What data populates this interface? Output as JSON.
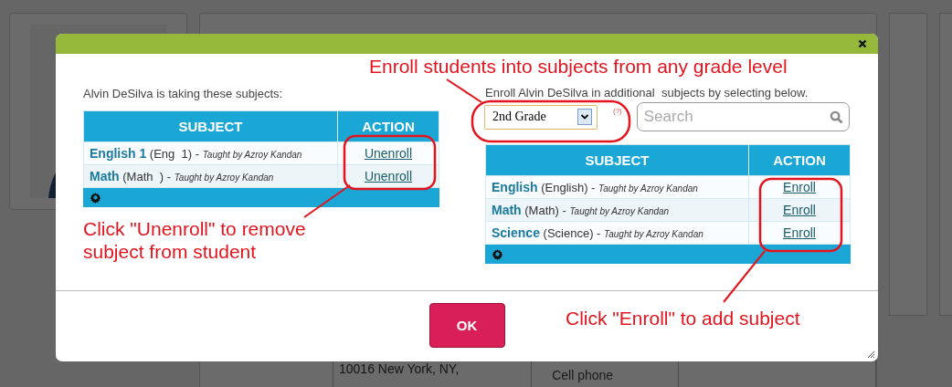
{
  "background": {
    "address_lines": [
      "10016 New York, NY,"
    ],
    "cell_phone_label": "Cell phone"
  },
  "dialog": {
    "current_intro": "Alvin DeSilva is taking these subjects:",
    "current_table": {
      "columns": [
        "SUBJECT",
        "ACTION"
      ],
      "rows": [
        {
          "subject": "**English 1** (Eng  1) - *Taught by Azroy Kandan*",
          "action": "Unenroll"
        },
        {
          "subject": "**Math** (Math  ) - *Taught by Azroy Kandan*",
          "action": "Unenroll"
        }
      ]
    },
    "add_intro": "Enroll Alvin DeSilva in additional  subjects by selecting below.",
    "grade_select": {
      "value": "2nd Grade"
    },
    "help_mark": "(?)",
    "search": {
      "placeholder": "Search"
    },
    "available_table": {
      "columns": [
        "SUBJECT",
        "ACTION"
      ],
      "rows": [
        {
          "subject": "**English** (English) - *Taught by Azroy Kandan*",
          "action": "Enroll"
        },
        {
          "subject": "**Math** (Math) - *Taught by Azroy Kandan*",
          "action": "Enroll"
        },
        {
          "subject": "**Science** (Science) - *Taught by Azroy Kandan*",
          "action": "Enroll"
        }
      ]
    },
    "ok_button": "OK"
  },
  "annotations": [
    {
      "kind": "grade",
      "text": "Enroll students into subjects from any grade level"
    },
    {
      "kind": "unenroll",
      "text": "Click \"Unenroll\" to remove subject from student"
    },
    {
      "kind": "enroll",
      "text": "Click \"Enroll\" to add subject"
    }
  ]
}
